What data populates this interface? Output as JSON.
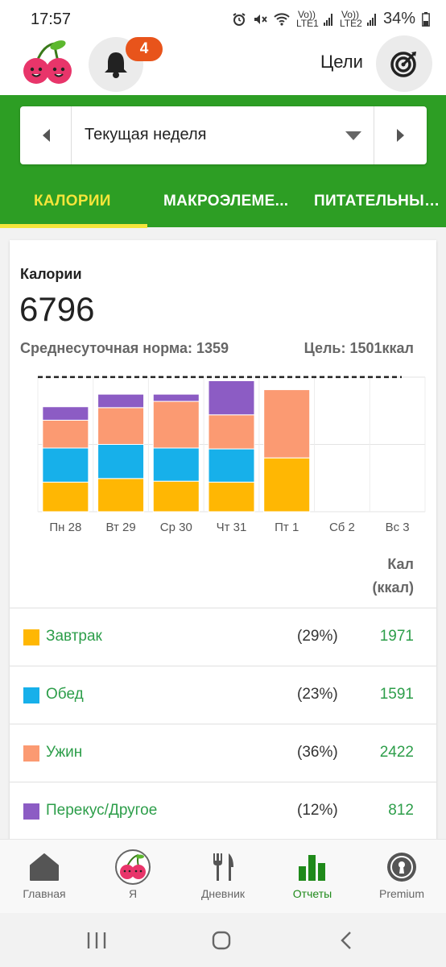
{
  "status_bar": {
    "time": "17:57",
    "sim1": "Vo)) LTE1",
    "sim2": "Vo)) LTE2",
    "battery": "34%"
  },
  "header": {
    "notification_count": "4",
    "goals_label": "Цели"
  },
  "week_selector": {
    "label": "Текущая неделя"
  },
  "tabs": [
    {
      "label": "КАЛОРИИ"
    },
    {
      "label": "МАКРОЭЛЕМЕ..."
    },
    {
      "label": "ПИТАТЕЛЬНЫЕ..."
    }
  ],
  "summary": {
    "title": "Калории",
    "total": "6796",
    "avg_label": "Среднесуточная норма: 1359",
    "goal_label": "Цель: 1501ккал"
  },
  "chart_data": {
    "type": "bar",
    "stacked": true,
    "categories": [
      "Пн 28",
      "Вт 29",
      "Ср 30",
      "Чт 31",
      "Пт 1",
      "Сб 2",
      "Вс 3"
    ],
    "series": [
      {
        "name": "Завтрак",
        "color": "#ffb703",
        "values": [
          330,
          370,
          340,
          330,
          600,
          0,
          0
        ]
      },
      {
        "name": "Обед",
        "color": "#17b0ea",
        "values": [
          380,
          380,
          370,
          370,
          0,
          0,
          0
        ]
      },
      {
        "name": "Ужин",
        "color": "#fb9a72",
        "values": [
          310,
          410,
          520,
          380,
          760,
          0,
          0
        ]
      },
      {
        "name": "Перекус/Другое",
        "color": "#8c5cc4",
        "values": [
          150,
          150,
          80,
          380,
          0,
          0,
          0
        ]
      }
    ],
    "goal_line": 1501,
    "ylim": [
      0,
      1500
    ],
    "grid": true
  },
  "table": {
    "col_head_line1": "Кал",
    "col_head_line2": "(ккал)",
    "rows": [
      {
        "name": "Завтрак",
        "pct": "(29%)",
        "value": "1971",
        "color": "#ffb703"
      },
      {
        "name": "Обед",
        "pct": "(23%)",
        "value": "1591",
        "color": "#17b0ea"
      },
      {
        "name": "Ужин",
        "pct": "(36%)",
        "value": "2422",
        "color": "#fb9a72"
      },
      {
        "name": "Перекус/Другое",
        "pct": "(12%)",
        "value": "812",
        "color": "#8c5cc4"
      }
    ]
  },
  "bottom_nav": [
    {
      "label": "Главная",
      "icon": "home-icon"
    },
    {
      "label": "Я",
      "icon": "cherry-avatar-icon"
    },
    {
      "label": "Дневник",
      "icon": "fork-knife-icon"
    },
    {
      "label": "Отчеты",
      "icon": "bar-chart-icon",
      "active": true
    },
    {
      "label": "Premium",
      "icon": "premium-badge-icon"
    }
  ],
  "colors": {
    "brand_green": "#2d9e24",
    "active_tab": "#f4e53a",
    "badge": "#e8541b"
  }
}
